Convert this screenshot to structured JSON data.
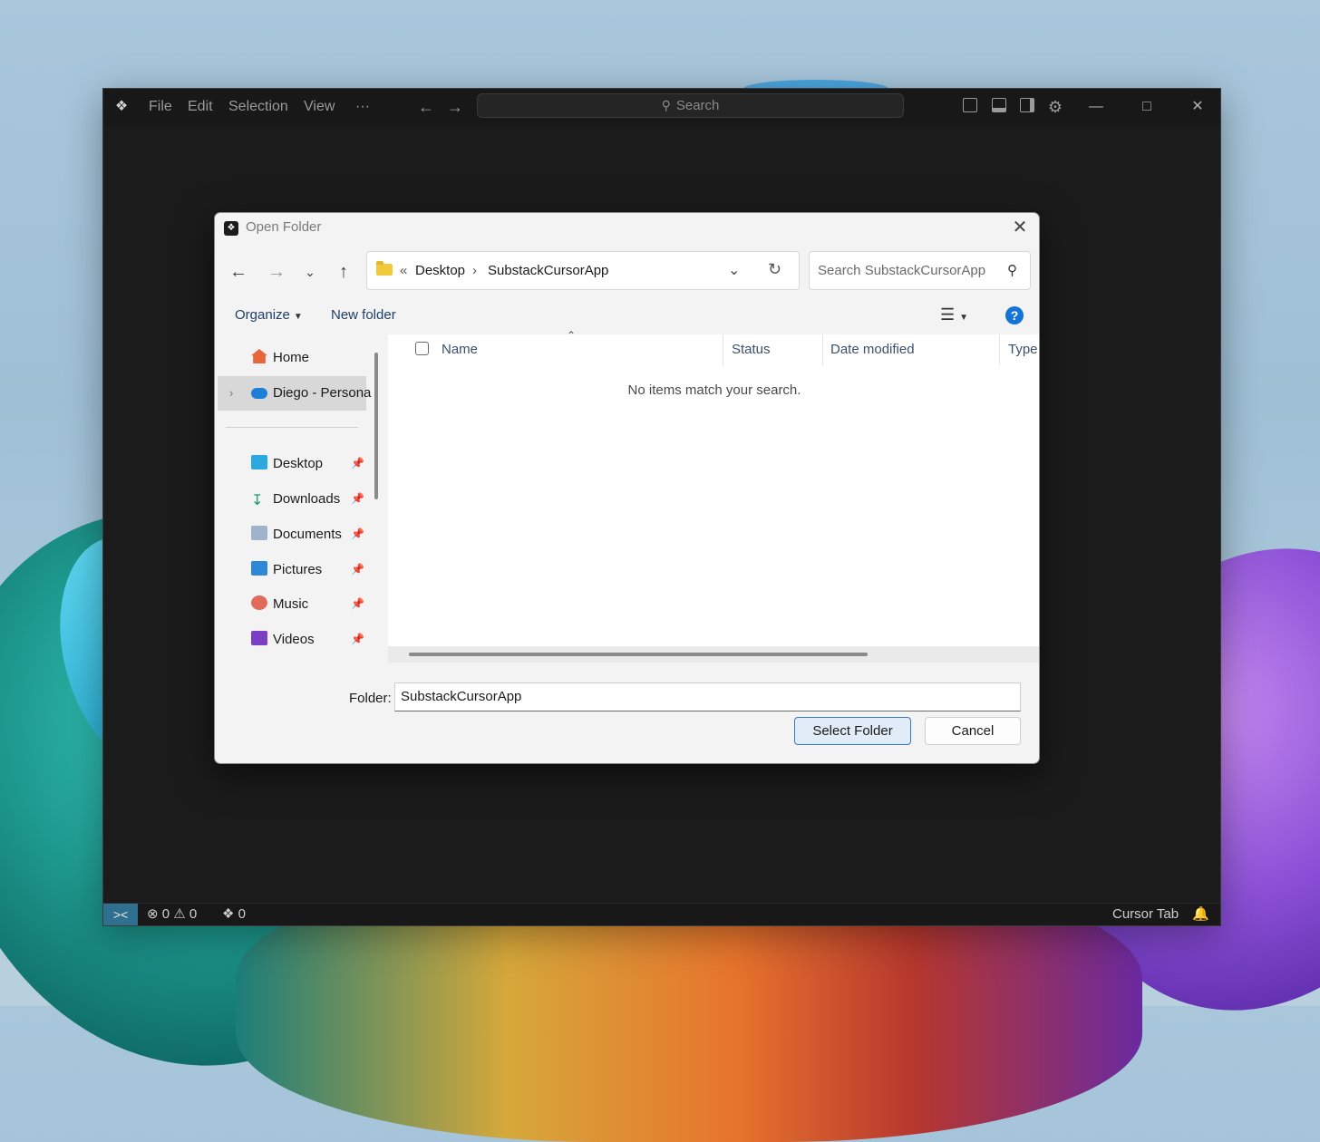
{
  "app": {
    "menu": [
      "File",
      "Edit",
      "Selection",
      "View",
      "···"
    ],
    "search_placeholder": "Search",
    "status": {
      "errors": "0",
      "warnings": "0",
      "ports": "0",
      "cursor_tab": "Cursor Tab"
    }
  },
  "dialog": {
    "title": "Open Folder",
    "address": {
      "overflow": "«",
      "crumbs": [
        "Desktop",
        "SubstackCursorApp"
      ],
      "separator": "›"
    },
    "search_placeholder": "Search SubstackCursorApp",
    "toolbar": {
      "organize": "Organize",
      "new_folder": "New folder",
      "help": "?"
    },
    "nav": {
      "home": "Home",
      "onedrive": "Diego - Persona",
      "quick_access": [
        "Desktop",
        "Downloads",
        "Documents",
        "Pictures",
        "Music",
        "Videos"
      ]
    },
    "columns": [
      "Name",
      "Status",
      "Date modified",
      "Type"
    ],
    "empty_message": "No items match your search.",
    "folder_label": "Folder:",
    "folder_value": "SubstackCursorApp",
    "buttons": {
      "select": "Select Folder",
      "cancel": "Cancel"
    }
  },
  "colors": {
    "accent": "#1573d6",
    "app_bg": "#1b1b1b",
    "dialog_bg": "#f3f3f3",
    "remote_indicator": "#2f6f8f"
  }
}
